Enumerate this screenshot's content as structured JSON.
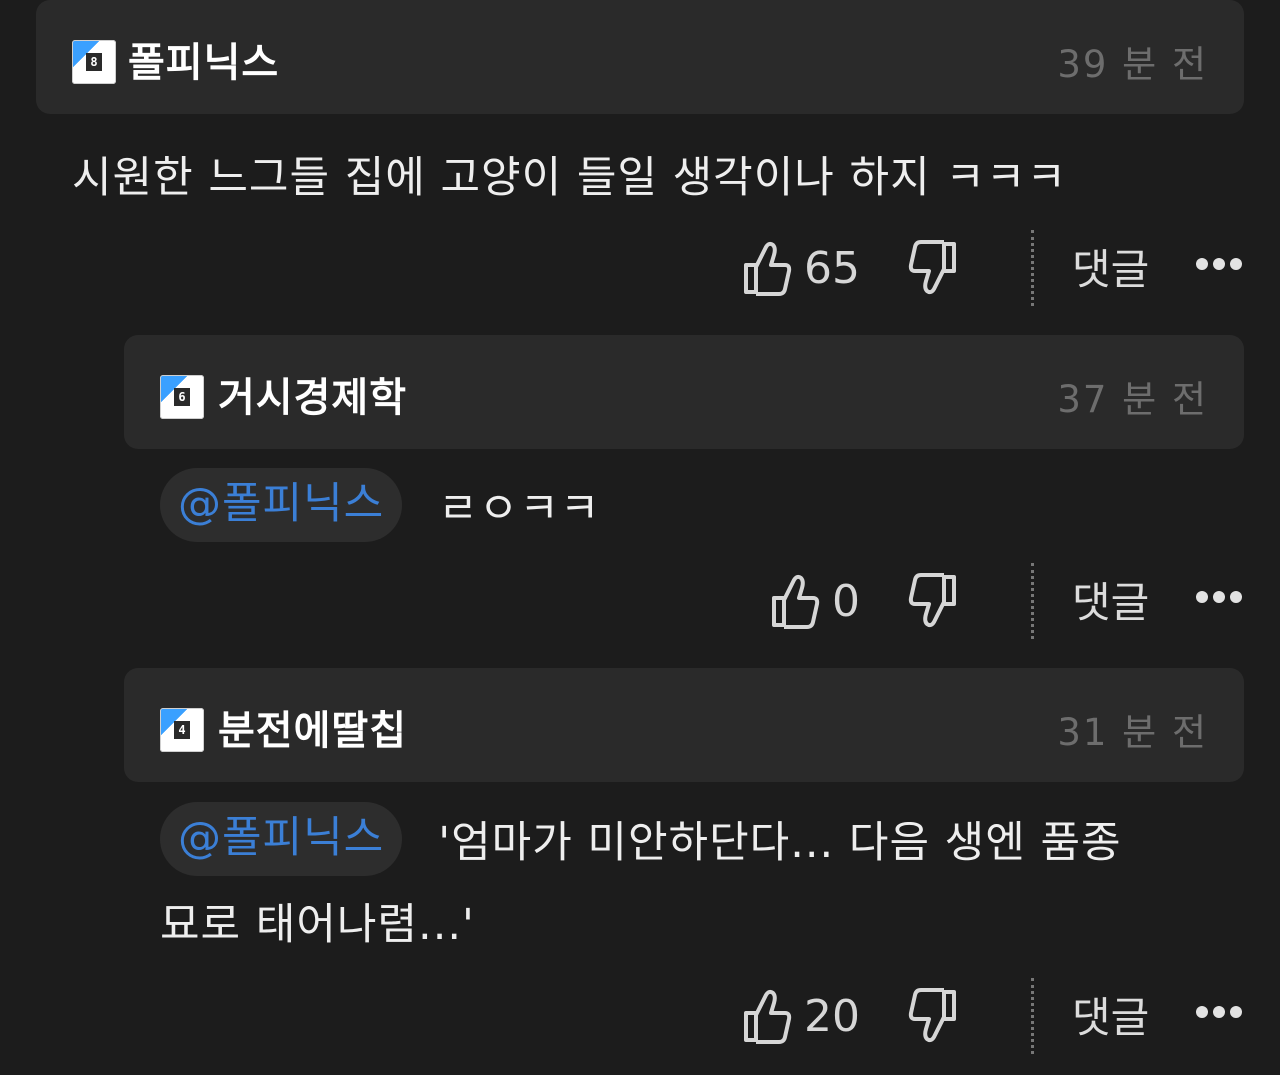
{
  "comments": [
    {
      "level": "8",
      "nickname": "폴피닉스",
      "time": "39 분 전",
      "mention": "",
      "text": "시원한 느그들 집에 고양이 들일 생각이나 하지 ㅋㅋㅋ",
      "likes": "65",
      "reply_label": "댓글"
    },
    {
      "level": "6",
      "nickname": "거시경제학",
      "time": "37 분 전",
      "mention": "@폴피닉스",
      "text": "ㄹㅇㅋㅋ",
      "likes": "0",
      "reply_label": "댓글"
    },
    {
      "level": "4",
      "nickname": "분전에딸칩",
      "time": "31 분 전",
      "mention": "@폴피닉스",
      "text_line1": "'엄마가 미안하단다... 다음 생엔 품종",
      "text_line2": "묘로 태어나렴...'",
      "likes": "20",
      "reply_label": "댓글"
    }
  ],
  "icons": {
    "like": "thumbs-up-icon",
    "dislike": "thumbs-down-icon",
    "more": "more-dots-icon"
  },
  "colors": {
    "background": "#1c1c1c",
    "header_bg": "#2a2a2a",
    "mention": "#3b7fd6",
    "time": "#6d6d6d"
  }
}
